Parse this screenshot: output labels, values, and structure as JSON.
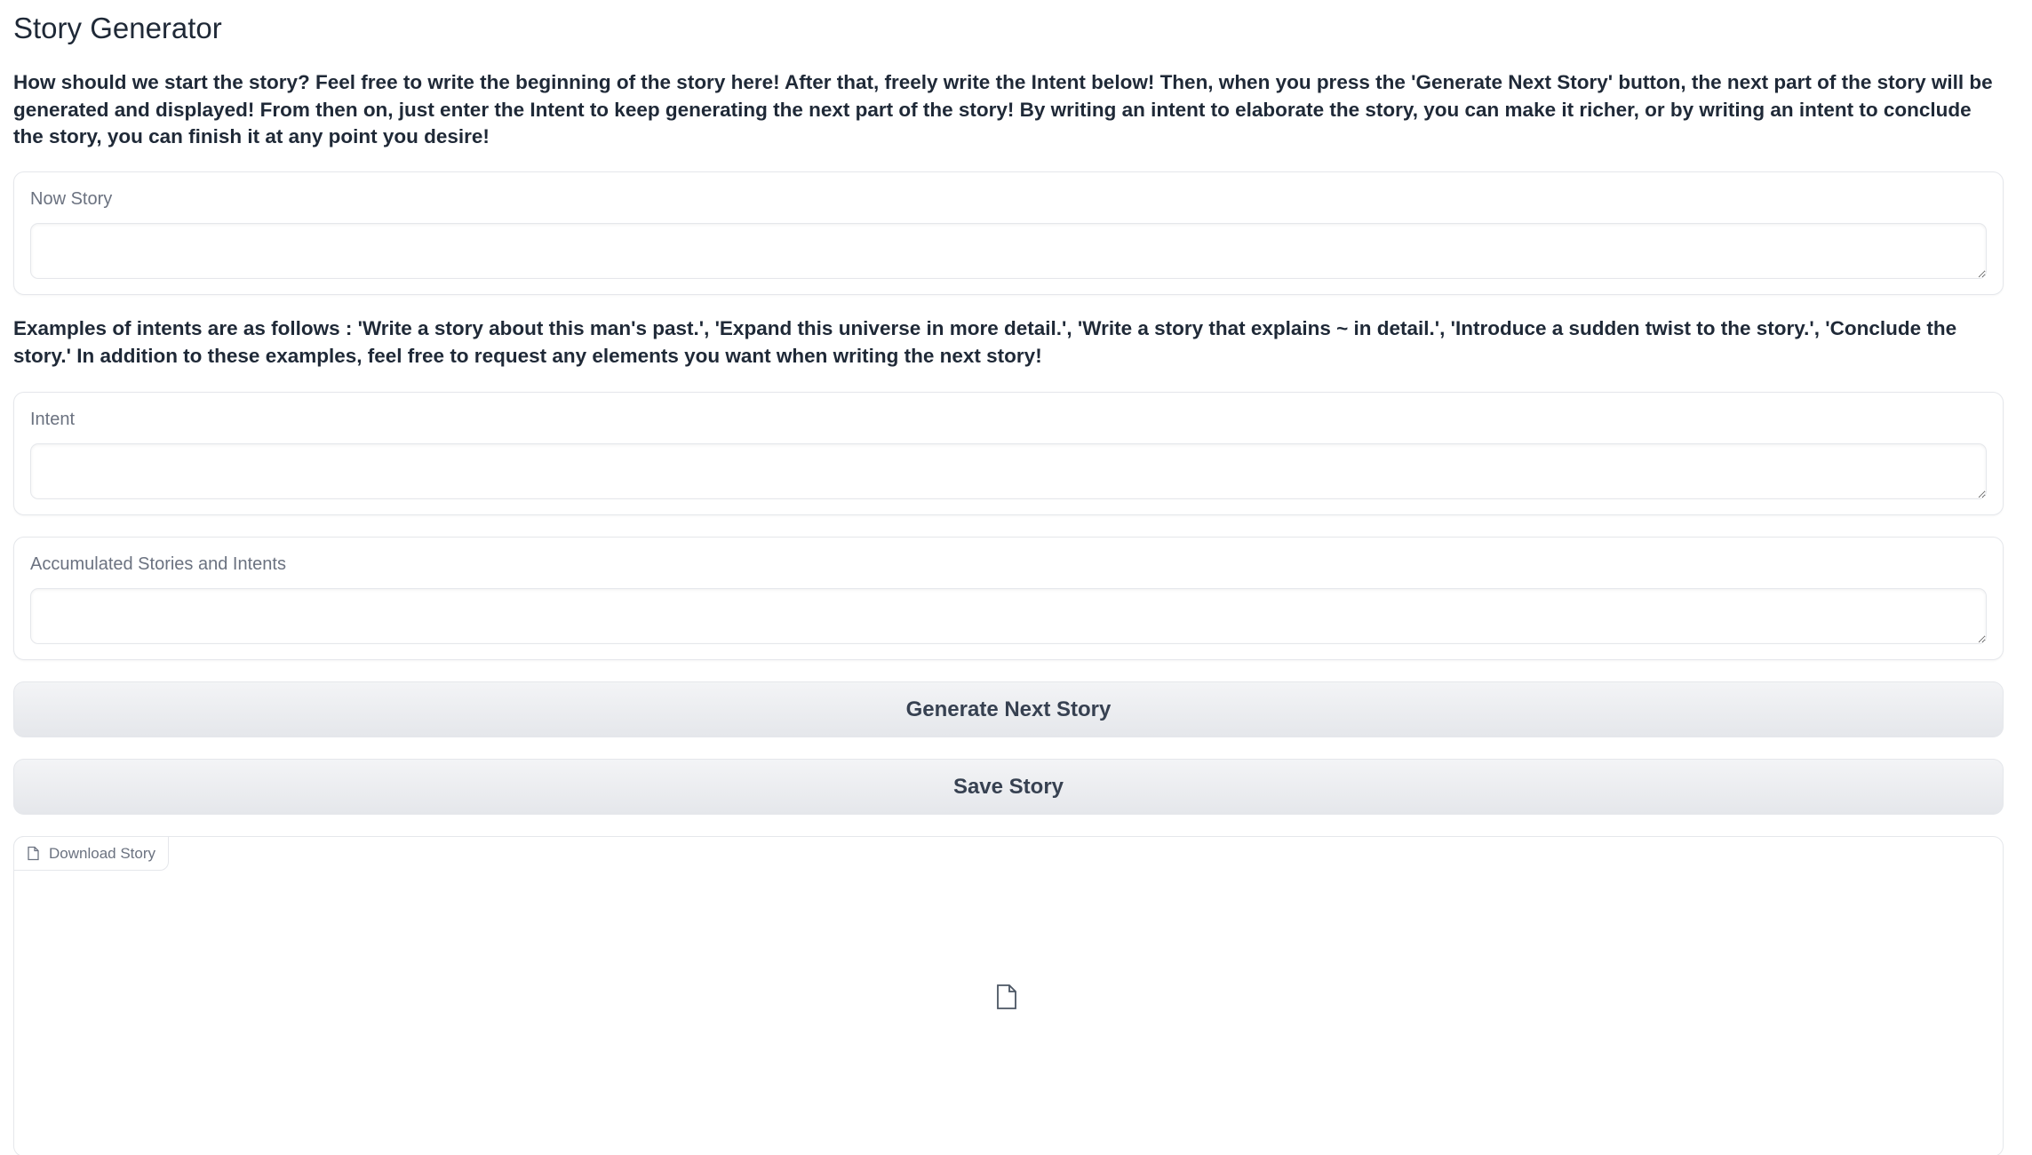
{
  "app": {
    "title": "Story Generator"
  },
  "intro_text": "How should we start the story? Feel free to write the beginning of the story here! After that, freely write the Intent below! Then, when you press the 'Generate Next Story' button, the next part of the story will be generated and displayed! From then on, just enter the Intent to keep generating the next part of the story! By writing an intent to elaborate the story, you can make it richer, or by writing an intent to conclude the story, you can finish it at any point you desire!",
  "now_story": {
    "label": "Now Story",
    "value": "",
    "placeholder": ""
  },
  "examples_text": "Examples of intents are as follows : 'Write a story about this man's past.', 'Expand this universe in more detail.', 'Write a story that explains ~ in detail.', 'Introduce a sudden twist to the story.', 'Conclude the story.' In addition to these examples, feel free to request any elements you want when writing the next story!",
  "intent": {
    "label": "Intent",
    "value": "",
    "placeholder": ""
  },
  "accumulated": {
    "label": "Accumulated Stories and Intents",
    "value": "",
    "placeholder": ""
  },
  "buttons": {
    "generate_label": "Generate Next Story",
    "save_label": "Save Story"
  },
  "download": {
    "label": "Download Story",
    "icon": "file-icon"
  },
  "colors": {
    "border": "#e5e7eb",
    "button_bg": "#e5e7eb",
    "label_text": "#6b7280",
    "body_text": "#1f2937"
  }
}
